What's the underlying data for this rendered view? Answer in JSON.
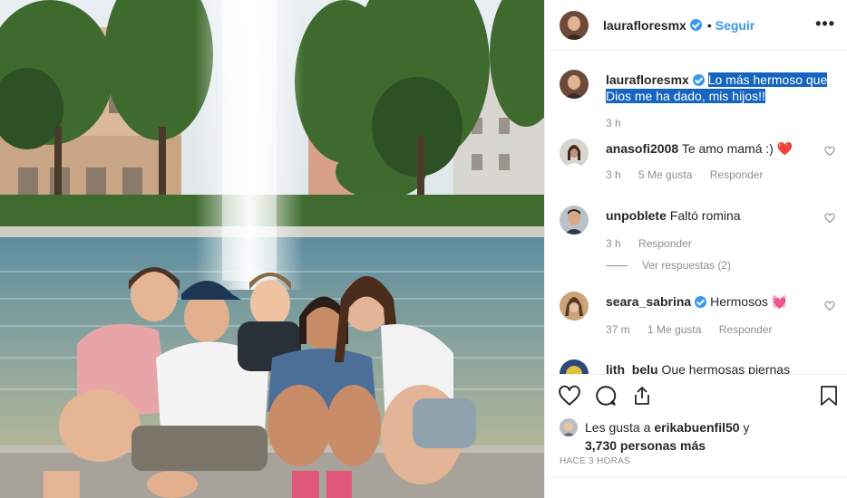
{
  "post": {
    "username": "lauraflores​mx",
    "follow_label": "Seguir",
    "more_label": "•••"
  },
  "caption": {
    "username": "lauraflores​mx",
    "text": "Lo más hermoso que Dios me ha dado, mis hijos!!",
    "time": "3 h"
  },
  "comments": [
    {
      "username": "anasofi2008",
      "text": "Te amo mamá :) ❤️",
      "time": "3 h",
      "likes": "5 Me gusta",
      "reply": "Responder"
    },
    {
      "username": "unpoblete",
      "text": "Faltó romina",
      "time": "3 h",
      "reply": "Responder",
      "view_replies": "Ver respuestas (2)"
    },
    {
      "username": "seara_sabrina",
      "text": "Hermosos 💓",
      "time": "37 m",
      "likes": "1 Me gusta",
      "reply": "Responder"
    },
    {
      "username": "lith_belu",
      "text": "Que hermosas piernas"
    }
  ],
  "likes": {
    "prefix": "Les gusta a",
    "user": "erikabuenfil50",
    "suffix": "y",
    "count": "3,730 personas más"
  },
  "timestamp": "HACE 3 HORAS",
  "colors": {
    "accent": "#3897f0",
    "selection": "#1565c0",
    "heart": "#ed4956"
  }
}
